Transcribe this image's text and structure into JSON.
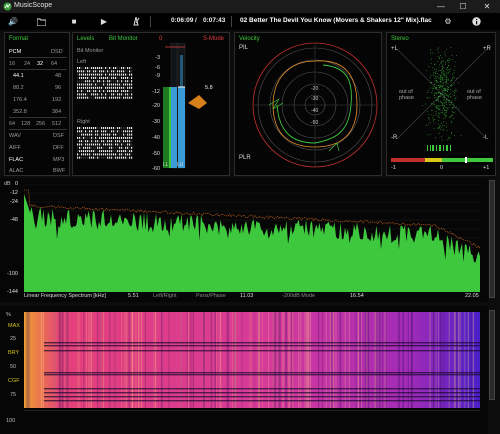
{
  "app": {
    "title": "MusicScope"
  },
  "window": {
    "minimize": "—",
    "maximize": "☐",
    "close": "✕"
  },
  "toolbar": {
    "elapsed": "0:06:09",
    "separator": "/",
    "total": "0:07:43",
    "track": "02 Better The Devil You Know (Movers & Shakers 12\" Mix).flac"
  },
  "format": {
    "title": "Format",
    "rows": [
      [
        "PCM",
        "DSD"
      ],
      [
        "16",
        "24",
        "32",
        "64"
      ],
      [
        "44.1",
        "48"
      ],
      [
        "88.2",
        "96"
      ],
      [
        "176.4",
        "192"
      ],
      [
        "352.8",
        "384"
      ],
      [
        "64",
        "128",
        "256",
        "512"
      ],
      [
        "WAV",
        "DSF"
      ],
      [
        "AIFF",
        "DFF"
      ],
      [
        "FLAC",
        "MP3"
      ],
      [
        "ALAC",
        "BWF"
      ]
    ]
  },
  "levels": {
    "title": "Levels",
    "mode": "Bit Monitor",
    "sub": "Bit Monitor",
    "left": "Left",
    "right": "Right"
  },
  "meter": {
    "mode": "S-Mode",
    "top_marker": "0",
    "peak_value": "5.8",
    "left_label": "LL",
    "right_label": "LU",
    "ticks": [
      "-3",
      "-6",
      "-9",
      "-12",
      "-20",
      "-30",
      "-40",
      "-50",
      "-60"
    ]
  },
  "velocity": {
    "title": "Velocity",
    "pil": "PIL",
    "plr": "PLR",
    "rings": [
      "-20",
      "-30",
      "-40",
      "-50"
    ]
  },
  "stereo": {
    "title": "Stereo",
    "plus_l": "+L",
    "plus_r": "+R",
    "minus_l": "-L",
    "minus_r": "-R",
    "out_of_phase": "out of\nphase",
    "corr_min": "-1",
    "corr_mid": "0",
    "corr_max": "+1"
  },
  "spectrum": {
    "unit": "dB",
    "yticks": [
      "0",
      "-12",
      "-24",
      "-36",
      "-48",
      "-60",
      "-72",
      "-84",
      "-96",
      "-108",
      "-120",
      "-132",
      "-144"
    ],
    "ylabels": [
      "0",
      "-12",
      "-24",
      "",
      "-48",
      "",
      "",
      "",
      "",
      "",
      "-100",
      "",
      "-144"
    ],
    "xlabel": "Linear Frequency Spectrum [kHz]",
    "xticks": [
      "5.51",
      "11.03",
      "16.54",
      "22.05"
    ],
    "modes": [
      "Left/Right",
      "Pans/Phase",
      "-200dB Mode"
    ]
  },
  "spectrogram": {
    "labels": [
      "%",
      "MAX",
      "25",
      "BRY",
      "50",
      "CGF",
      "75",
      "100"
    ]
  },
  "colors": {
    "accent_green": "#3ec83e",
    "accent_red": "#e03c3c",
    "meter_blue": "#3a9bd6"
  }
}
